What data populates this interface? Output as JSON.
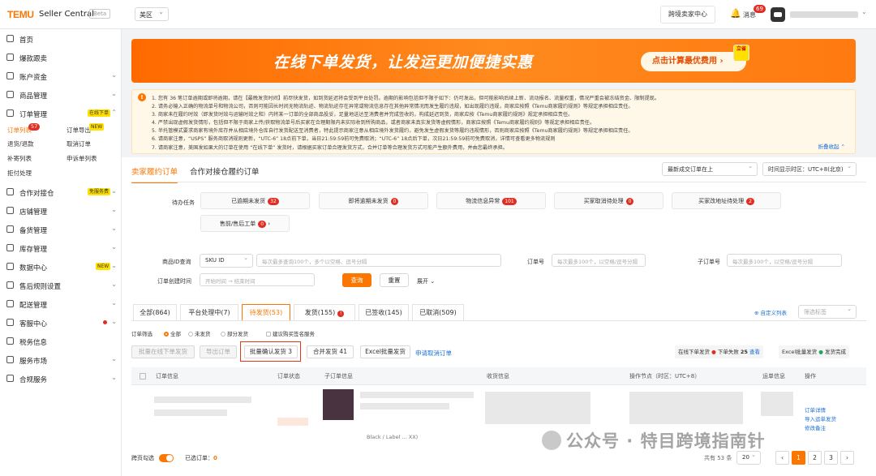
{
  "header": {
    "logo": "TEMU",
    "product": "Seller Central",
    "beta": "Beta",
    "region": "美区",
    "cross_button": "跨境卖家中心",
    "messages_label": "消息",
    "messages_count": "69"
  },
  "sidebar": {
    "items": [
      {
        "label": "首页",
        "icon": "home-icon"
      },
      {
        "label": "爆款跟卖",
        "icon": "fire-icon"
      },
      {
        "label": "账户资金",
        "icon": "wallet-icon"
      },
      {
        "label": "商品管理",
        "icon": "box-icon"
      },
      {
        "label": "订单管理",
        "icon": "order-icon",
        "tag": "在线下单"
      },
      {
        "label": "合作对接仓",
        "icon": "warehouse-icon",
        "tag": "免服务费"
      },
      {
        "label": "店铺管理",
        "icon": "shop-icon"
      },
      {
        "label": "备货管理",
        "icon": "stock-icon"
      },
      {
        "label": "库存管理",
        "icon": "inventory-icon"
      },
      {
        "label": "数据中心",
        "icon": "data-icon",
        "tag": "NEW"
      },
      {
        "label": "售后规则设置",
        "icon": "after-sale-icon"
      },
      {
        "label": "配送管理",
        "icon": "delivery-icon"
      },
      {
        "label": "客服中心",
        "icon": "service-icon"
      },
      {
        "label": "税务信息",
        "icon": "tax-icon"
      },
      {
        "label": "服务市场",
        "icon": "market-icon"
      },
      {
        "label": "合规服务",
        "icon": "compliance-icon"
      }
    ],
    "order_sub": {
      "order_list": "订单列表",
      "order_list_badge": "57",
      "order_export": "订单导出",
      "export_tag": "NEW",
      "refund": "退货/退款",
      "cancel": "取消订单",
      "reship": "补寄列表",
      "apply": "申诉单列表",
      "reject": "拒付处理"
    }
  },
  "banner": {
    "title": "在线下单发货，让发运更加便捷实惠",
    "button": "点击计算最优费用 ›",
    "sticker": "立省"
  },
  "notice": {
    "lines": [
      "1. 您有 36 笔订单逾期或即将逾期，请在【最晚发货时间】前尽快发货，如到货延迟将会受到平台处罚。逾期的影响包括但不限于如下：仍可发出，但可能影响后续上新、流动报名、流量权重，情况严重会被冻结资金、限制提现。",
      "2. 请务必输入正确的物流单号和物流公司，否则可能因长时间无物流轨迹、物流轨迹存在异常或物流信息存在其他异常情况而发生履约违规，如出现履约违规，商家应按照《Temu商家履约规则》等规定承担相应责任。",
      "3. 商家未在履约时效（即发货时效与运输时效之和）内将某一订单的全部商品投妥，足量地送达至消费者并完成签收的，构成延迟到货，商家应按《Temu商家履约规则》规定承担相应责任。",
      "4. 严禁出现虚假发货情形，包括但不限于商家上传/获取物流单号后买家在合理期限内未实际收到所购商品，或者商家未真实发货等虚假情形，商家应按照《Temu商家履约规则》等规定承担相应责任。",
      "5. 半托管模式要求商家有境外库存并从相应境外仓库自行发货配送至消费者，特此提示商家注意从相应境外发货履约，避免发生虚假发货等履约违规情形，否则商家应按照《Temu商家履约规则》等规定承担相应责任。",
      "6. 请商家注意，“USPS” 服务商取消规则更新，“UTC-6” 18点前下单，当日21:59:59前可免费取消；“UTC-6” 18点后下单，次日21:59:59前可免费取消，详情可查看更多物流规则",
      "7. 请商家注意，美国发如果大的订单在使用 “在线下单” 发货时，请根据买家订单合理发货方式，合并订单等合理发货方式可能产生额外费用，并由您最终承担。"
    ],
    "fold": "折叠收起 ⌃"
  },
  "main": {
    "tab_active": "卖家履约订单",
    "tab_other": "合作对接仓履约订单",
    "sort": "最新成交订单在上",
    "timezone": "时间显示时区：UTC+8(北京)",
    "task_label": "待办任务",
    "tasks": [
      {
        "label": "已逾期未发货",
        "count": "32"
      },
      {
        "label": "即将逾期未发货",
        "count": "0"
      },
      {
        "label": "物流信息异常",
        "count": "101"
      },
      {
        "label": "买家取消待处理",
        "count": "0"
      },
      {
        "label": "买家改地址待处理",
        "count": "2"
      },
      {
        "label": "售前/售后工单",
        "count": "0"
      }
    ],
    "filters": {
      "product_label": "商品ID查询",
      "sku": "SKU ID",
      "product_ph": "每次最多查询100个，多个以空格、逗号分隔",
      "order_label": "订单号",
      "order_ph": "每次最多100个，以空格/逗号分隔",
      "sub_label": "子订单号",
      "sub_ph": "每次最多100个，以空格/逗号分隔",
      "time_label": "订单创建时间",
      "time_ph": "开始时间  →  结束时间",
      "search": "查询",
      "reset": "重置",
      "expand": "展开 ⌄"
    },
    "status_tabs": [
      {
        "label": "全部(864)"
      },
      {
        "label": "平台处理中(7)"
      },
      {
        "label": "待发货(53)"
      },
      {
        "label": "发货(155)"
      },
      {
        "label": "已签收(145)"
      },
      {
        "label": "已取消(509)"
      }
    ],
    "custom_cols": "⊕ 自定义列表",
    "filter_tag": "筛选标签",
    "order_filter": {
      "label": "订单筛选",
      "all": "全部",
      "unshipped": "未发货",
      "partial": "部分发货",
      "recommend": "建议购买签名服务"
    },
    "actions": {
      "online": "批量在线下单发货",
      "export": "导出订单",
      "confirm": "批量确认发货 3",
      "merge": "合并发货",
      "merge_count": "41",
      "excel": "Excel批量发货",
      "apply_cancel": "申请取消订单"
    },
    "chips": {
      "online_ship": "在线下单发货",
      "fail": "下单失败",
      "fail_count": "25",
      "view": "查看",
      "excel_ship": "Excel批量发货",
      "done": "发货完成"
    },
    "columns": [
      "订单信息",
      "订单状态",
      "子订单信息",
      "收货信息",
      "操作节点（时区：UTC+8）",
      "运单信息",
      "操作"
    ],
    "row": {
      "sub_text": "Black / Label ... XX)",
      "op1": "订单详情",
      "op2": "导入运单发货",
      "op3": "修改备注"
    },
    "footer": {
      "select_page": "跨页勾选",
      "selected": "已选订单：",
      "selected_count": "0",
      "total": "共有 53 条",
      "per_page": "20",
      "pages": [
        "1",
        "2",
        "3"
      ]
    }
  },
  "watermark": "公众号 · 特目跨境指南针"
}
